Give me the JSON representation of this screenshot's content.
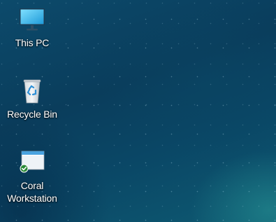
{
  "desktop": {
    "icons": [
      {
        "label": "This PC",
        "icon": "monitor-icon"
      },
      {
        "label": "Recycle Bin",
        "icon": "recycle-bin-icon"
      },
      {
        "label": "Coral\nWorkstation",
        "icon": "app-window-icon",
        "overlay": "checkmark-badge-icon"
      }
    ]
  },
  "colors": {
    "wallpaper_base": "#0a3d5c",
    "wallpaper_highlight": "#2a9696",
    "label_text": "#ffffff",
    "badge_green": "#2e8b3a"
  }
}
